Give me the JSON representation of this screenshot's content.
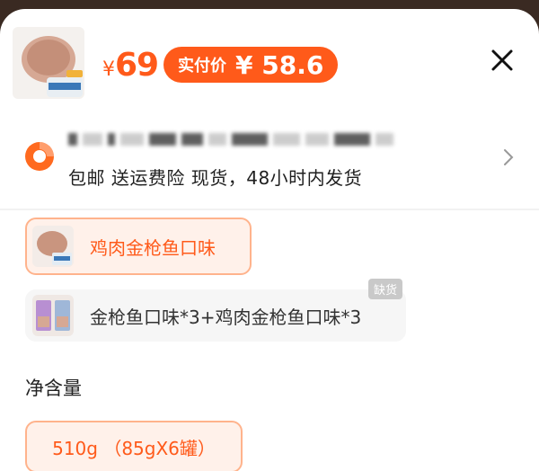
{
  "product": {
    "image_alt": "canned cat food"
  },
  "price": {
    "currency": "¥",
    "amount": "69",
    "paid_label": "实付价",
    "paid_currency": "¥",
    "paid_amount": "58.6"
  },
  "shipping": {
    "info": "包邮 送运费险 现货，48小时内发货"
  },
  "options": {
    "flavors": [
      {
        "label": "鸡肉金枪鱼口味",
        "selected": true
      },
      {
        "label": "金枪鱼口味*3+鸡肉金枪鱼口味*3",
        "selected": false,
        "badge": "缺货"
      }
    ],
    "net_content_title": "净含量",
    "sizes": [
      {
        "label": "510g （85gX6罐）",
        "selected": true
      }
    ]
  },
  "colors": {
    "accent": "#ff5a1a",
    "selected_bg": "#fff1ea",
    "selected_border": "#ffb38c",
    "unavailable_badge": "#c9c9c9"
  }
}
